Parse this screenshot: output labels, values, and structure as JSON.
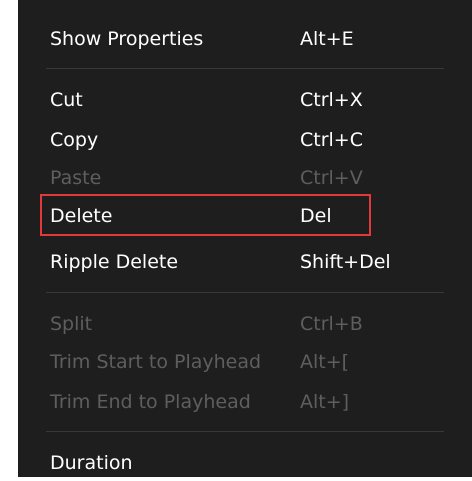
{
  "menu": {
    "items": [
      {
        "label": "Show Properties",
        "shortcut": "Alt+E"
      },
      {
        "label": "Cut",
        "shortcut": "Ctrl+X"
      },
      {
        "label": "Copy",
        "shortcut": "Ctrl+C"
      },
      {
        "label": "Paste",
        "shortcut": "Ctrl+V"
      },
      {
        "label": "Delete",
        "shortcut": "Del"
      },
      {
        "label": "Ripple Delete",
        "shortcut": "Shift+Del"
      },
      {
        "label": "Split",
        "shortcut": "Ctrl+B"
      },
      {
        "label": "Trim Start to Playhead",
        "shortcut": "Alt+["
      },
      {
        "label": "Trim End to Playhead",
        "shortcut": "Alt+]"
      },
      {
        "label": "Duration",
        "shortcut": ""
      }
    ]
  },
  "colors": {
    "menu_background": "#1e1e1e",
    "enabled_text": "#ffffff",
    "disabled_text": "#5e5e5e",
    "separator": "#383838",
    "highlight_border": "#e23a3a"
  },
  "icons": {
    "highlight": "red-rectangle-outline"
  }
}
